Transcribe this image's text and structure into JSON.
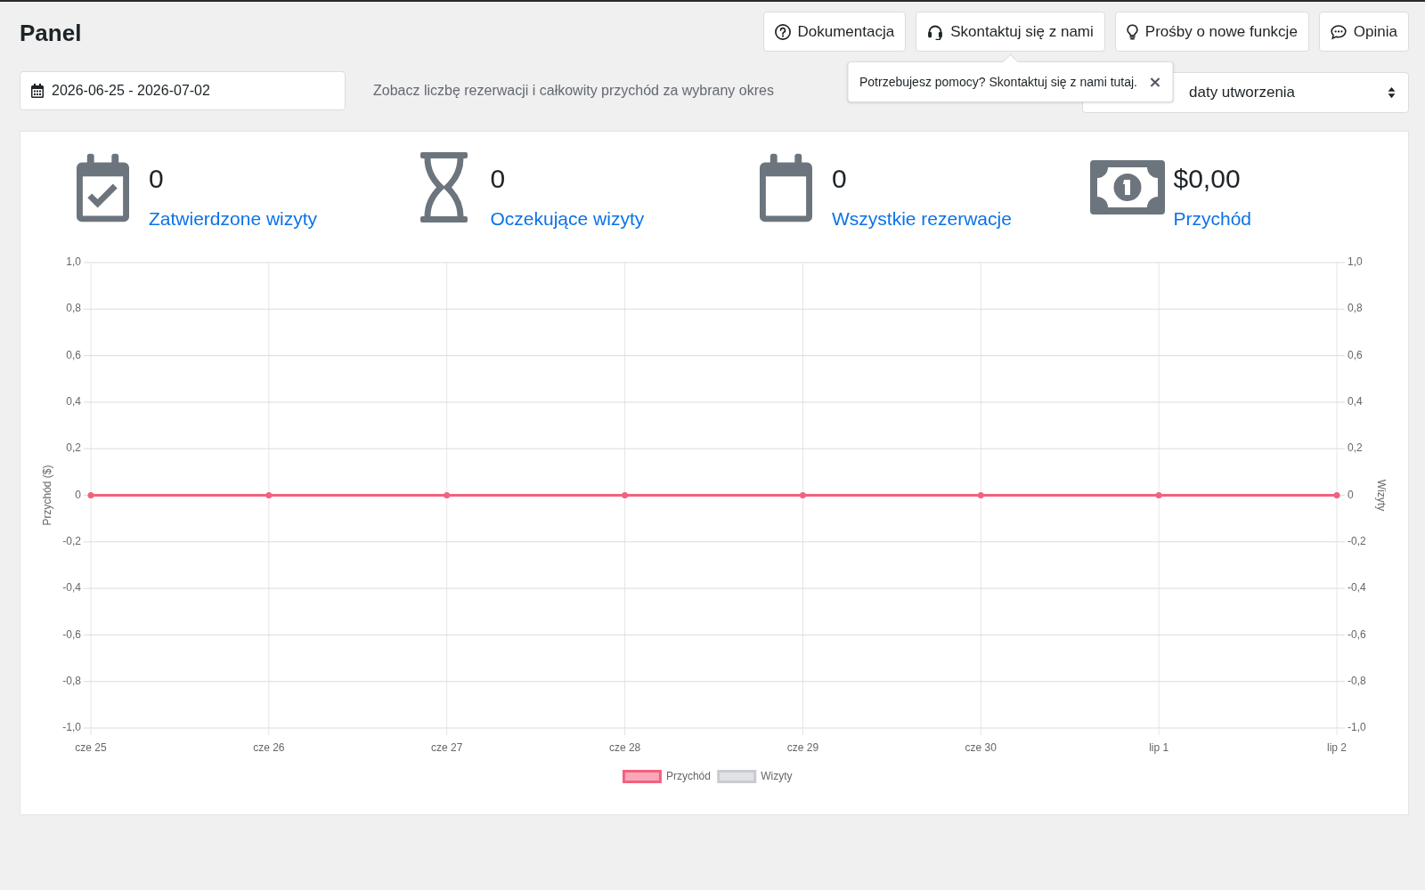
{
  "header": {
    "title": "Panel",
    "buttons": [
      {
        "kind": "docs",
        "label": "Dokumentacja"
      },
      {
        "kind": "contact",
        "label": "Skontaktuj się z nami",
        "tooltip": "Potrzebujesz pomocy? Skontaktuj się z nami tutaj."
      },
      {
        "kind": "feature",
        "label": "Prośby o nowe funkcje"
      },
      {
        "kind": "feedback",
        "label": "Opinia"
      }
    ]
  },
  "filters": {
    "date_range": "2026-06-25 - 2026-07-02",
    "description": "Zobacz liczbę rezerwacji i całkowity przychód za wybrany okres",
    "sort_select": "daty utworzenia"
  },
  "stats": [
    {
      "kind": "approved",
      "value": "0",
      "label": "Zatwierdzone wizyty"
    },
    {
      "kind": "pending",
      "value": "0",
      "label": "Oczekujące wizyty"
    },
    {
      "kind": "all",
      "value": "0",
      "label": "Wszystkie rezerwacje"
    },
    {
      "kind": "revenue",
      "value": "$0,00",
      "label": "Przychód"
    }
  ],
  "chart_data": {
    "type": "line",
    "ylabel": "Przychód ($)",
    "y2label": "Wizyty",
    "grid": true,
    "categories": [
      "cze 25",
      "cze 26",
      "cze 27",
      "cze 28",
      "cze 29",
      "cze 30",
      "lip 1",
      "lip 2"
    ],
    "series": [
      {
        "name": "Przychód",
        "color": "#f3617f",
        "marker": "circle",
        "values": [
          0,
          0,
          0,
          0,
          0,
          0,
          0,
          0
        ]
      }
    ],
    "legend": {
      "extra_entries": [
        {
          "label": "Wizyty",
          "color": "#c9cbcf"
        }
      ]
    },
    "ylim": [
      -1,
      1
    ],
    "yticks": [
      {
        "value": 1,
        "label": "1,0"
      },
      {
        "value": 0.8,
        "label": "0,8"
      },
      {
        "value": 0.6,
        "label": "0,6"
      },
      {
        "value": 0.4,
        "label": "0,4"
      },
      {
        "value": 0.2,
        "label": "0,2"
      },
      0,
      {
        "value": -0.2,
        "label": "-0,2"
      },
      {
        "value": -0.4,
        "label": "-0,4"
      },
      {
        "value": -0.6,
        "label": "-0,6"
      },
      {
        "value": -0.8,
        "label": "-0,8"
      },
      {
        "value": -1,
        "label": "-1,0"
      }
    ],
    "y2lim": [
      -1,
      1
    ],
    "y2ticks": [
      {
        "value": 1,
        "label": "1,0"
      },
      {
        "value": 0.8,
        "label": "0,8"
      },
      {
        "value": 0.6,
        "label": "0,6"
      },
      {
        "value": 0.4,
        "label": "0,4"
      },
      {
        "value": 0.2,
        "label": "0,2"
      },
      0,
      {
        "value": -0.2,
        "label": "-0,2"
      },
      {
        "value": -0.4,
        "label": "-0,4"
      },
      {
        "value": -0.6,
        "label": "-0,6"
      },
      {
        "value": -0.8,
        "label": "-0,8"
      },
      {
        "value": -1,
        "label": "-1,0"
      }
    ]
  }
}
